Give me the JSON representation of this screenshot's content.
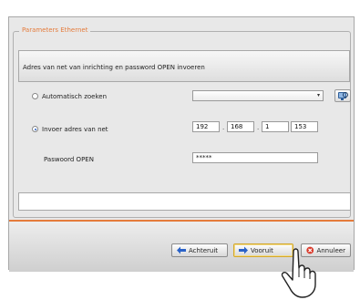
{
  "group": {
    "title": "Parameters Ethernet"
  },
  "banner": {
    "text": "Adres van net van inrichting en password OPEN invoeren"
  },
  "options": {
    "auto": {
      "label": "Automatisch zoeken",
      "selected": false
    },
    "manual": {
      "label": "Invoer adres van net",
      "selected": true
    }
  },
  "auto_select": {
    "value": ""
  },
  "ip": {
    "octet1": "192",
    "octet2": "168",
    "octet3": "1",
    "octet4": "153"
  },
  "password": {
    "label": "Paswoord OPEN",
    "value": "*****"
  },
  "footer": {
    "back_label": "Achteruit",
    "next_label": "Vooruit",
    "cancel_label": "Annuleer"
  },
  "colors": {
    "accent": "#e57b3b",
    "arrow_blue": "#2a62c8",
    "cancel_red": "#d93a2b"
  },
  "icons": {
    "search": "search-computer-icon",
    "back": "arrow-left-icon",
    "next": "arrow-right-icon",
    "cancel": "close-icon",
    "pointer": "hand-pointer-icon"
  }
}
